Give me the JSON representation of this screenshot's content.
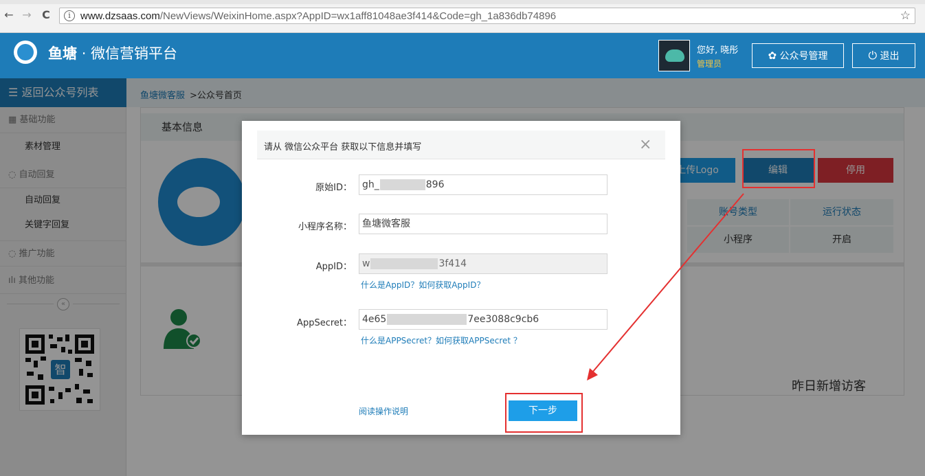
{
  "browser": {
    "back_icon": "←",
    "forward_icon": "→",
    "reload_icon": "C",
    "info_icon": "i",
    "url_host": "www.dzsaas.com",
    "url_path": "/NewViews/WeixinHome.aspx?AppID=wx1aff81048ae3f414&Code=gh_1a836db74896",
    "star_icon": "☆"
  },
  "header": {
    "brand_name": "鱼塘",
    "brand_sep": "·",
    "brand_suffix": "微信营销平台",
    "greeting": "您好, 晓彤",
    "role": "管理员",
    "manage_button": "公众号管理",
    "logout_button": "退出",
    "gear_icon": "✿",
    "power_icon": "⏻"
  },
  "sidebar": {
    "back_label": "返回公众号列表",
    "groups": [
      {
        "label": "基础功能",
        "items": [
          "素材管理"
        ]
      },
      {
        "label": "自动回复",
        "items": [
          "自动回复",
          "关键字回复"
        ]
      },
      {
        "label": "推广功能",
        "items": []
      },
      {
        "label": "其他功能",
        "items": []
      }
    ],
    "collapse_icon": "«",
    "qr_badge": "智"
  },
  "breadcrumb": {
    "link": "鱼塘微客服",
    "current": ">公众号首页"
  },
  "main": {
    "panel_title": "基本信息",
    "upload_logo": "上传Logo",
    "edit_button": "编辑",
    "disable_button": "停用",
    "table_headers": [
      "账号类型",
      "运行状态"
    ],
    "table_values": [
      "小程序",
      "开启"
    ],
    "visitors_label": "昨日新增访客"
  },
  "dialog": {
    "title": "请从 微信公众平台 获取以下信息并填写",
    "close_icon": "×",
    "fields": [
      {
        "label": "原始ID：",
        "value_start": "gh_",
        "value_end": "896"
      },
      {
        "label": "小程序名称：",
        "value": "鱼塘微客服"
      },
      {
        "label": "AppID：",
        "value_start": "w",
        "value_end": "3f414"
      },
      {
        "label": "AppSecret：",
        "value_start": "4e65",
        "value_end": "7ee3088c9cb6"
      }
    ],
    "appid_help": "什么是AppID？如何获取AppID？",
    "appsecret_help": "什么是APPSecret？如何获取APPSecret ？",
    "read_instructions": "阅读操作说明",
    "next_button": "下一步"
  },
  "colors": {
    "primary": "#1e7cb8",
    "edit_button": "#1e7cb8",
    "disable_button": "#d9363e",
    "next_button": "#1e9ee8",
    "annotation": "#e43030"
  }
}
